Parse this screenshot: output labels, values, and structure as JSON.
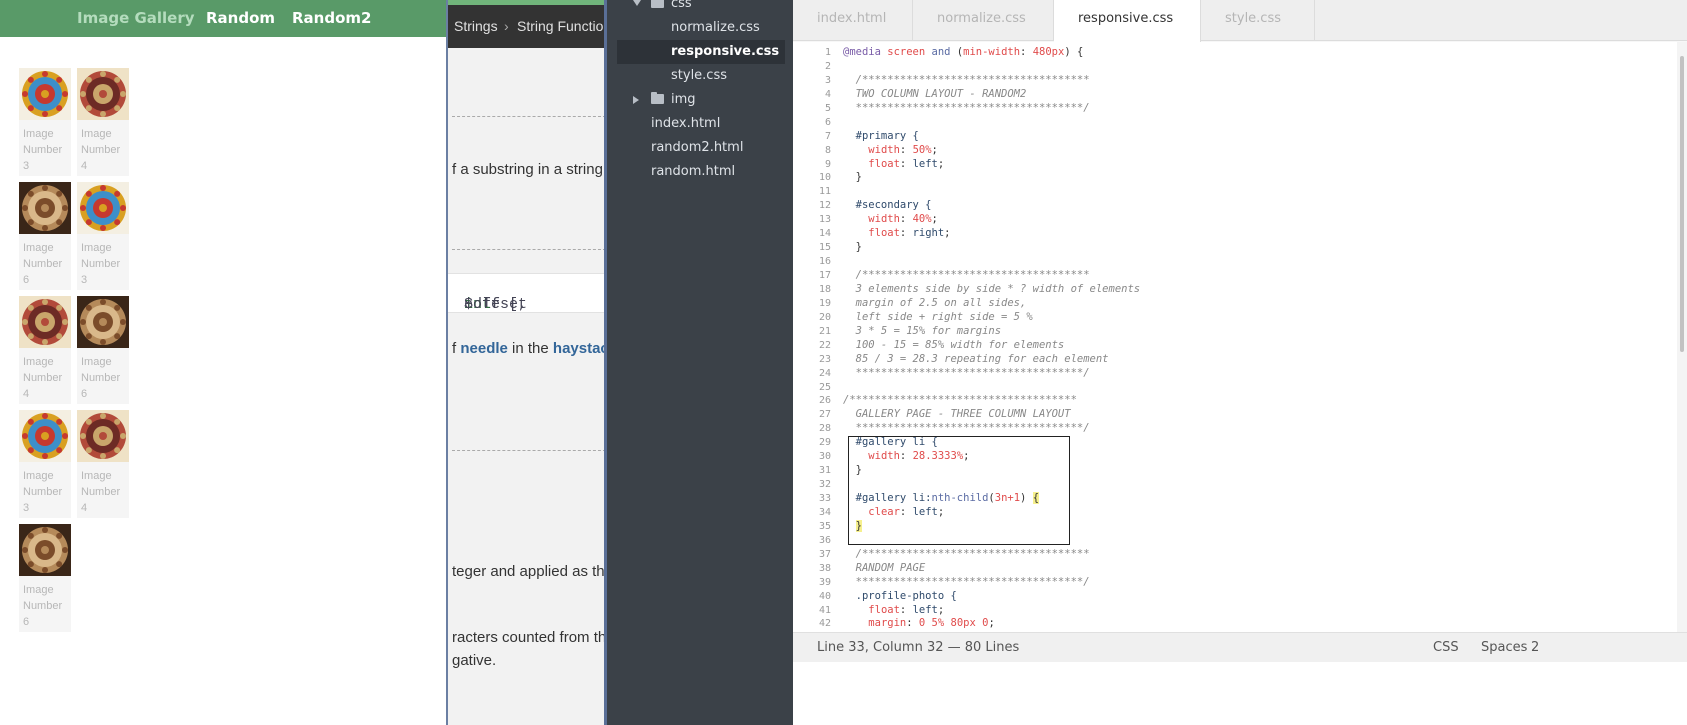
{
  "gallery": {
    "nav": {
      "brand": "Image Gallery",
      "link1": "Random",
      "link2": "Random2"
    },
    "items": [
      {
        "caption": "Image\nNumber\n3",
        "art": "gold"
      },
      {
        "caption": "Image\nNumber\n4",
        "art": "cream"
      },
      {
        "caption": "Image\nNumber\n6",
        "art": "dark"
      },
      {
        "caption": "Image\nNumber\n3",
        "art": "gold"
      },
      {
        "caption": "Image\nNumber\n4",
        "art": "cream"
      },
      {
        "caption": "Image\nNumber\n6",
        "art": "dark"
      },
      {
        "caption": "Image\nNumber\n3",
        "art": "gold"
      },
      {
        "caption": "Image\nNumber\n4",
        "art": "cream"
      },
      {
        "caption": "Image\nNumber\n6",
        "art": "dark"
      }
    ]
  },
  "docs": {
    "crumb1": "Strings",
    "crumb_sep": "›",
    "crumb2": "String Functions",
    "text1": "f a substring in a string",
    "code_a": "edle [, ",
    "code_kw": "int",
    "code_b": " $offset",
    "text2_a": "f ",
    "text2_needle": "needle",
    "text2_b": " in the ",
    "text2_hay": "haystack",
    "text3": "teger and applied as the",
    "text4": "racters counted from the",
    "text5": "gative."
  },
  "editor": {
    "tree": [
      {
        "label": "css",
        "kind": "folder-open"
      },
      {
        "label": "normalize.css",
        "kind": "file"
      },
      {
        "label": "responsive.css",
        "kind": "file",
        "selected": true
      },
      {
        "label": "style.css",
        "kind": "file"
      },
      {
        "label": "img",
        "kind": "folder-closed"
      },
      {
        "label": "index.html",
        "kind": "root-file"
      },
      {
        "label": "random2.html",
        "kind": "root-file"
      },
      {
        "label": "random.html",
        "kind": "root-file"
      }
    ],
    "tabs": [
      {
        "label": "index.html"
      },
      {
        "label": "normalize.css"
      },
      {
        "label": "responsive.css",
        "active": true
      },
      {
        "label": "style.css"
      }
    ],
    "code_lines": [
      [
        [
          "@media",
          "mq"
        ],
        [
          " screen ",
          "str"
        ],
        [
          "and",
          "kw"
        ],
        [
          " (",
          "def"
        ],
        [
          "min-width",
          "str"
        ],
        [
          ": ",
          "def"
        ],
        [
          "480px",
          "num"
        ],
        [
          ") {",
          "def"
        ]
      ],
      [],
      [
        [
          "  /************************************",
          "com"
        ]
      ],
      [
        [
          "  TWO COLUMN LAYOUT - RANDOM2",
          "com"
        ]
      ],
      [
        [
          "  ************************************/",
          "com"
        ]
      ],
      [],
      [
        [
          "  #primary {",
          "sel"
        ]
      ],
      [
        [
          "    ",
          "def"
        ],
        [
          "width",
          "prop"
        ],
        [
          ": ",
          "def"
        ],
        [
          "50%",
          "num"
        ],
        [
          ";",
          "def"
        ]
      ],
      [
        [
          "    ",
          "def"
        ],
        [
          "float",
          "prop"
        ],
        [
          ": ",
          "def"
        ],
        [
          "left",
          "val"
        ],
        [
          ";",
          "def"
        ]
      ],
      [
        [
          "  }",
          "def"
        ]
      ],
      [],
      [
        [
          "  #secondary {",
          "sel"
        ]
      ],
      [
        [
          "    ",
          "def"
        ],
        [
          "width",
          "prop"
        ],
        [
          ": ",
          "def"
        ],
        [
          "40%",
          "num"
        ],
        [
          ";",
          "def"
        ]
      ],
      [
        [
          "    ",
          "def"
        ],
        [
          "float",
          "prop"
        ],
        [
          ": ",
          "def"
        ],
        [
          "right",
          "val"
        ],
        [
          ";",
          "def"
        ]
      ],
      [
        [
          "  }",
          "def"
        ]
      ],
      [],
      [
        [
          "  /************************************",
          "com"
        ]
      ],
      [
        [
          "  3 elements side by side * ? width of elements",
          "com"
        ]
      ],
      [
        [
          "  margin of 2.5 on all sides,",
          "com"
        ]
      ],
      [
        [
          "  left side + right side = 5 %",
          "com"
        ]
      ],
      [
        [
          "  3 * 5 = 15% for margins",
          "com"
        ]
      ],
      [
        [
          "  100 - 15 = 85% width for elements",
          "com"
        ]
      ],
      [
        [
          "  85 / 3 = 28.3 repeating for each element",
          "com"
        ]
      ],
      [
        [
          "  ************************************/",
          "com"
        ]
      ],
      [],
      [
        [
          "/************************************",
          "com"
        ]
      ],
      [
        [
          "  GALLERY PAGE - THREE COLUMN LAYOUT",
          "com"
        ]
      ],
      [
        [
          "  ************************************/",
          "com"
        ]
      ],
      [
        [
          "  #gallery li {",
          "sel"
        ]
      ],
      [
        [
          "    ",
          "def"
        ],
        [
          "width",
          "prop"
        ],
        [
          ": ",
          "def"
        ],
        [
          "28.3333%",
          "num"
        ],
        [
          ";",
          "def"
        ]
      ],
      [
        [
          "  }",
          "def"
        ]
      ],
      [],
      [
        [
          "  #gallery li:",
          "sel"
        ],
        [
          "nth-child",
          "kw"
        ],
        [
          "(",
          "def"
        ],
        [
          "3n+1",
          "num"
        ],
        [
          ") ",
          "def"
        ],
        [
          "{",
          "brace"
        ]
      ],
      [
        [
          "    ",
          "def"
        ],
        [
          "clear",
          "prop"
        ],
        [
          ": ",
          "def"
        ],
        [
          "left",
          "val"
        ],
        [
          ";",
          "def"
        ]
      ],
      [
        [
          "  ",
          "def"
        ],
        [
          "}",
          "brace"
        ]
      ],
      [],
      [
        [
          "  /************************************",
          "com"
        ]
      ],
      [
        [
          "  RANDOM PAGE",
          "com"
        ]
      ],
      [
        [
          "  ************************************/",
          "com"
        ]
      ],
      [
        [
          "  .profile-photo {",
          "sel"
        ]
      ],
      [
        [
          "    ",
          "def"
        ],
        [
          "float",
          "prop"
        ],
        [
          ": ",
          "def"
        ],
        [
          "left",
          "val"
        ],
        [
          ";",
          "def"
        ]
      ],
      [
        [
          "    ",
          "def"
        ],
        [
          "margin",
          "prop"
        ],
        [
          ": ",
          "def"
        ],
        [
          "0 5% 80px 0",
          "num"
        ],
        [
          ";",
          "def"
        ]
      ]
    ],
    "status": {
      "position": "Line 33, Column 32 — 80 Lines",
      "mode": "CSS",
      "indent": "Spaces",
      "indent_size": "2"
    }
  }
}
